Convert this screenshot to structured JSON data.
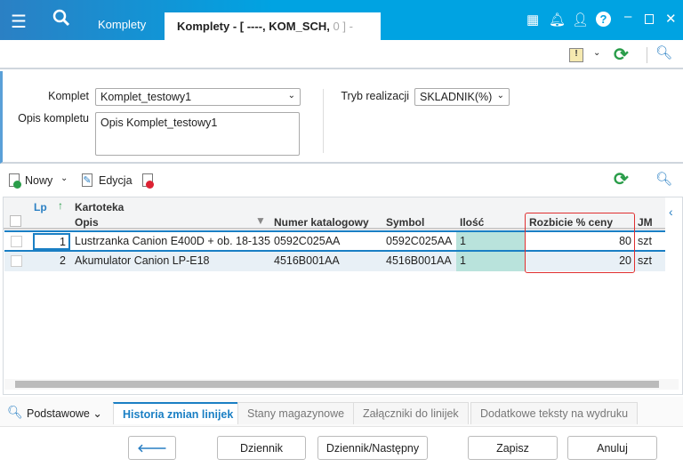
{
  "titlebar": {
    "tabs": [
      {
        "label": "Komplety"
      },
      {
        "label": "Komplety - [ ----, KOM_SCH, ",
        "suffix": "0 ] -"
      }
    ],
    "icons": [
      "menu-icon",
      "search-icon",
      "apps-icon",
      "bell-icon",
      "user-icon",
      "help-icon",
      "minimize-icon",
      "maximize-icon",
      "close-icon"
    ]
  },
  "form": {
    "komplet_label": "Komplet",
    "komplet_value": "Komplet_testowy1",
    "opis_label": "Opis kompletu",
    "opis_value": "Opis Komplet_testowy1",
    "tryb_label": "Tryb realizacji",
    "tryb_value": "SKLADNIK(%)"
  },
  "grid_toolbar": {
    "new_label": "Nowy",
    "edit_label": "Edycja"
  },
  "grid": {
    "group_header": "Kartoteka",
    "lp_header": "Lp",
    "columns": [
      "Opis",
      "Numer katalogowy",
      "Symbol",
      "Ilość",
      "Rozbicie % ceny",
      "JM"
    ],
    "rows": [
      {
        "lp": "1",
        "opis": "Lustrzanka Canion E400D + ob. 18-135",
        "numer": "0592C025AA",
        "symbol": "0592C025AA",
        "ilosc": "1",
        "rozbicie": "80",
        "jm": "szt"
      },
      {
        "lp": "2",
        "opis": "Akumulator Canion LP-E18",
        "numer": "4516B001AA",
        "symbol": "4516B001AA",
        "ilosc": "1",
        "rozbicie": "20",
        "jm": "szt"
      }
    ]
  },
  "bottom_tabs": {
    "view_label": "Podstawowe",
    "tabs": [
      "Historia zmian linijek",
      "Stany magazynowe",
      "Załączniki do linijek",
      "Dodatkowe teksty na wydruku"
    ]
  },
  "buttons": {
    "back": "🡐",
    "dziennik": "Dziennik",
    "dziennik_next": "Dziennik/Następny",
    "save": "Zapisz",
    "cancel": "Anuluj"
  },
  "colors": {
    "accent": "#00a3e2",
    "highlight_border": "#e03030",
    "qty_bg": "#b9e3dc",
    "selected_row_line": "#1a7fc4"
  }
}
